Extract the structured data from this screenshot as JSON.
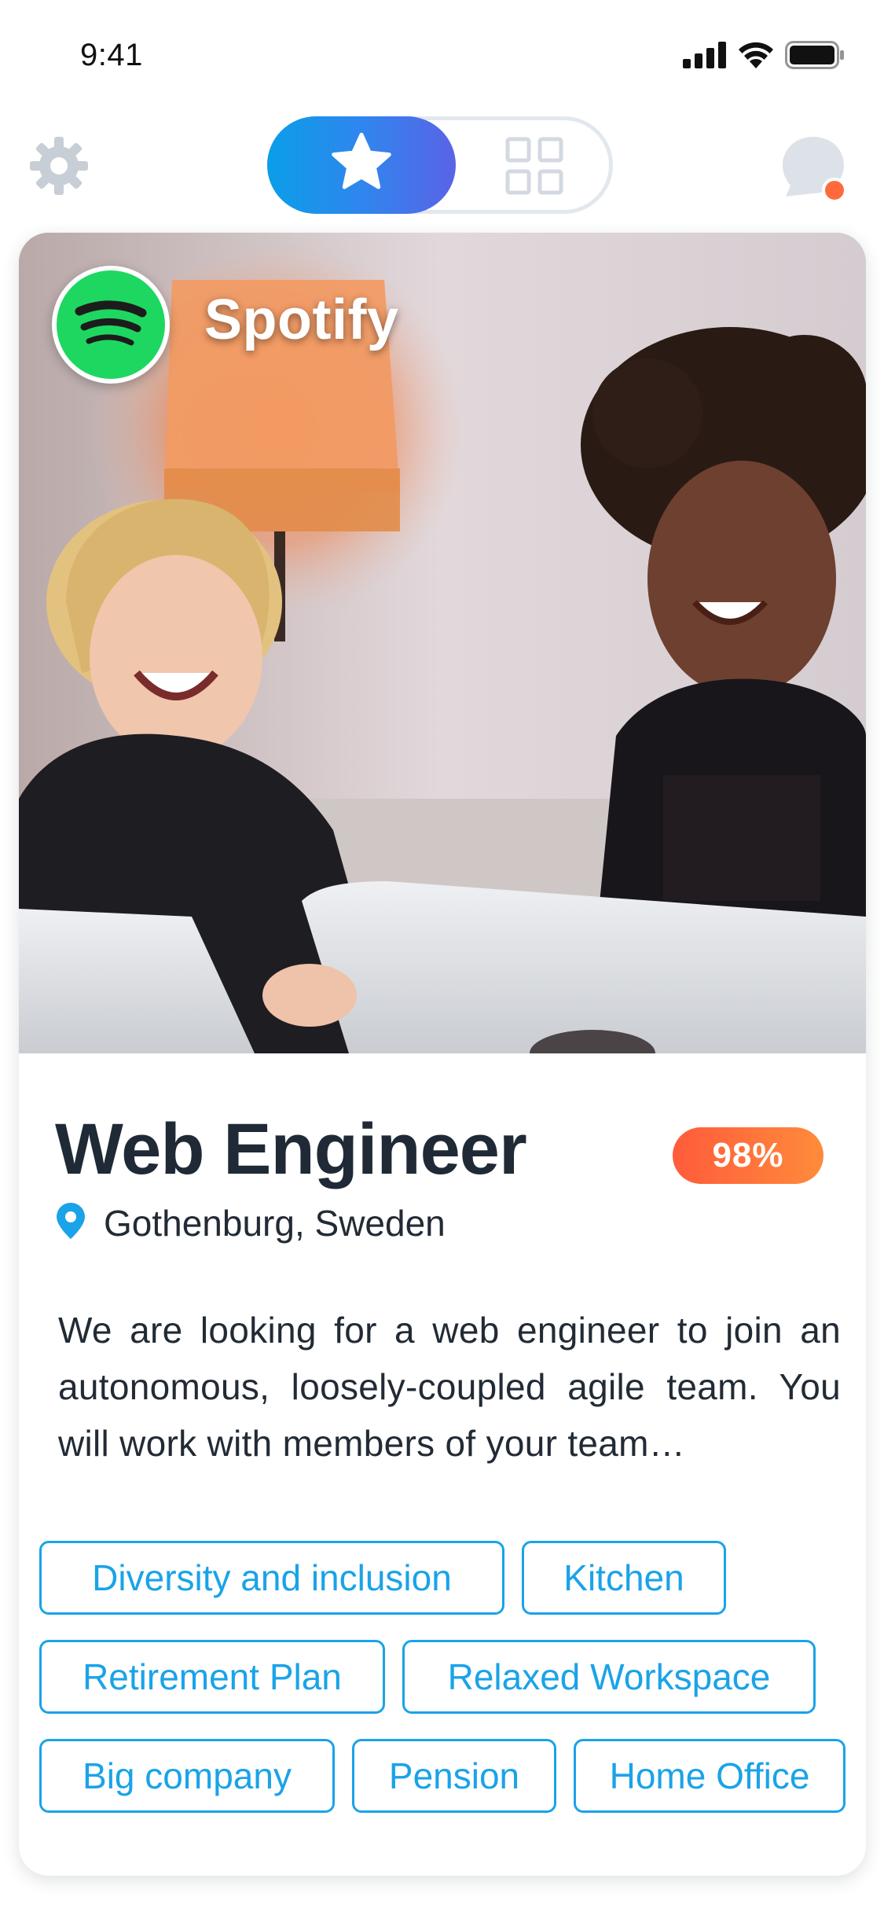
{
  "status_bar": {
    "time": "9:41",
    "icons": [
      "cellular-signal-icon",
      "wifi-icon",
      "battery-icon"
    ]
  },
  "nav": {
    "left_icon": "gear-icon",
    "segments": [
      {
        "icon": "star-icon",
        "selected": true
      },
      {
        "icon": "grid-icon",
        "selected": false
      }
    ],
    "right_icon": "chat-bubble-icon",
    "has_notification_dot": true
  },
  "card": {
    "company": {
      "name": "Spotify",
      "logo_icon": "spotify-logo-icon",
      "logo_color": "#1ED760"
    },
    "photo_description_icon": "team-photo",
    "job_title": "Web Engineer",
    "match": "98%",
    "location": "Gothenburg, Sweden",
    "description": "We are looking for a web engineer to join an autonomous, loosely-coupled agile team. You will work with members of your team…",
    "tags": [
      [
        "Diversity and inclusion",
        "Kitchen"
      ],
      [
        "Retirement Plan",
        "Relaxed Workspace"
      ],
      [
        "Big company",
        "Pension",
        "Home Office"
      ]
    ]
  },
  "colors": {
    "accent_blue": "#1AA3E8",
    "segment_gradient_start": "#0A9EE8",
    "segment_gradient_end": "#5A63E6",
    "badge_gradient_start": "#FF5B3B",
    "badge_gradient_end": "#FF8B3B",
    "notification_dot": "#FF6A3D",
    "title_text": "#1F2A36"
  }
}
